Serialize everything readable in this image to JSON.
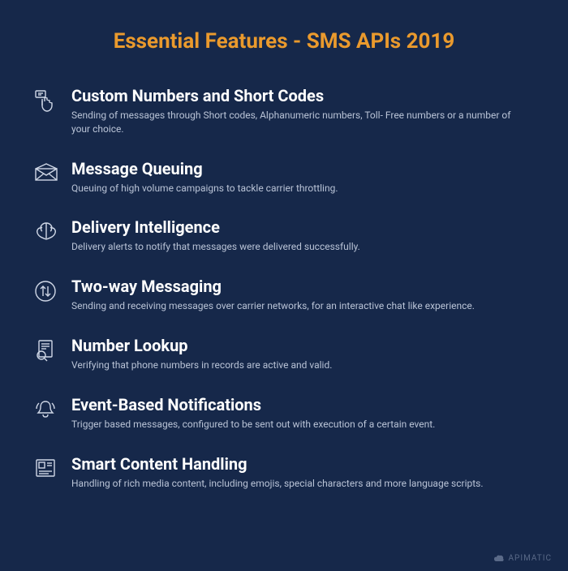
{
  "title": "Essential Features - SMS APIs 2019",
  "features": [
    {
      "title": "Custom Numbers and Short Codes",
      "desc": "Sending of messages through Short codes, Alphanumeric numbers, Toll- Free numbers or a number of your choice."
    },
    {
      "title": "Message Queuing",
      "desc": "Queuing of high volume campaigns to tackle carrier throttling."
    },
    {
      "title": "Delivery Intelligence",
      "desc": "Delivery alerts to notify that messages were delivered successfully."
    },
    {
      "title": "Two-way Messaging",
      "desc": "Sending and receiving messages over carrier networks, for an interactive chat like experience."
    },
    {
      "title": "Number Lookup",
      "desc": "Verifying that phone numbers in records are active and valid."
    },
    {
      "title": "Event-Based Notifications",
      "desc": "Trigger based messages, configured to be sent out with execution of a certain event."
    },
    {
      "title": "Smart Content Handling",
      "desc": "Handling of rich media content, including emojis, special characters and more language scripts."
    }
  ],
  "footer": "APIMATIC"
}
